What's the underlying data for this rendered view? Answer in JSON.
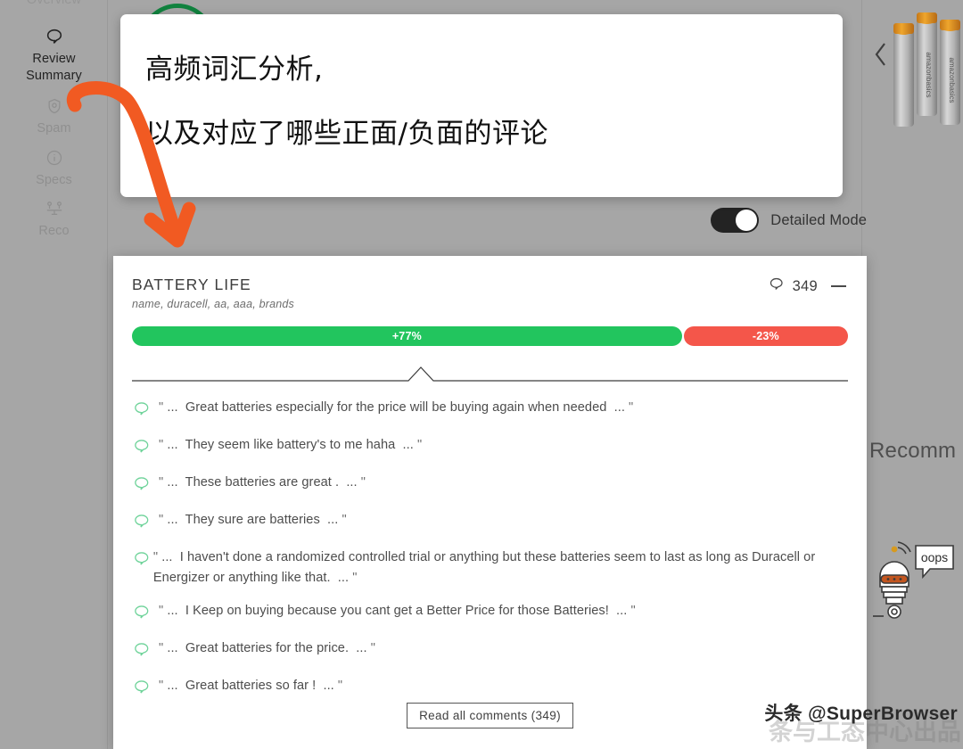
{
  "colors": {
    "positive": "#22c55e",
    "negative": "#f4564a",
    "accent_arrow": "#f15a22",
    "ring_green": "#11833f",
    "page_background": "#a6a6a6",
    "toggle_on": "#232323"
  },
  "sidebar": {
    "items": [
      {
        "label": "Overview",
        "icon": "grid-icon",
        "active": false
      },
      {
        "label": "Review Summary",
        "icon": "comment-icon",
        "active": true
      },
      {
        "label": "Spam",
        "icon": "shield-icon",
        "active": false
      },
      {
        "label": "Specs",
        "icon": "info-icon",
        "active": false
      },
      {
        "label": "Reco",
        "icon": "scale-icon",
        "active": false
      }
    ]
  },
  "right_panel": {
    "prev_icon": "chevron-left-icon",
    "product_image_alt": "amazonbasics-aa-batteries",
    "recommend_heading": "Recomm",
    "robot_bubble_text": "oops"
  },
  "toggle": {
    "label": "Detailed Mode",
    "state": "on"
  },
  "card": {
    "title": "BATTERY LIFE",
    "subtitle": "name, duracell, aa, aaa, brands",
    "comment_icon": "comment-icon",
    "comment_count": "349",
    "collapse_icon": "minus-icon",
    "sentiment": {
      "positive_label": "+77%",
      "negative_label": "-23%",
      "positive_percent": 77,
      "negative_percent": 23
    },
    "quotes": [
      {
        "open": "\"",
        "ellipsis_left": "...",
        "text": "Great batteries especially for the price will be buying again when needed",
        "ellipsis_right": "...",
        "close": "\""
      },
      {
        "open": "\"",
        "ellipsis_left": "...",
        "text": "They seem like battery's to me haha",
        "ellipsis_right": "...",
        "close": "\""
      },
      {
        "open": "\"",
        "ellipsis_left": "...",
        "text": "These batteries are great .",
        "ellipsis_right": "...",
        "close": "\""
      },
      {
        "open": "\"",
        "ellipsis_left": "...",
        "text": "They sure are batteries",
        "ellipsis_right": "...",
        "close": "\""
      },
      {
        "open": "\"",
        "ellipsis_left": "...",
        "text": "I haven't done a randomized controlled trial or anything but these batteries seem to last as long as Duracell or Energizer or anything like that.",
        "ellipsis_right": "...",
        "close": "\""
      },
      {
        "open": "\"",
        "ellipsis_left": "...",
        "text": "I Keep on buying because you cant get a Better Price for those Batteries!",
        "ellipsis_right": "...",
        "close": "\""
      },
      {
        "open": "\"",
        "ellipsis_left": "...",
        "text": "Great batteries for the price.",
        "ellipsis_right": "...",
        "close": "\""
      },
      {
        "open": "\"",
        "ellipsis_left": "...",
        "text": "Great batteries so far !",
        "ellipsis_right": "...",
        "close": "\""
      }
    ],
    "read_all_label": "Read all comments (349)"
  },
  "annotation": {
    "line1": "高频词汇分析,",
    "line2": "以及对应了哪些正面/负面的评论",
    "arrow_icon": "curved-arrow-icon"
  },
  "watermark": {
    "text": "头条 @SuperBrowser",
    "ghost_text": "条与工态中心出品"
  }
}
